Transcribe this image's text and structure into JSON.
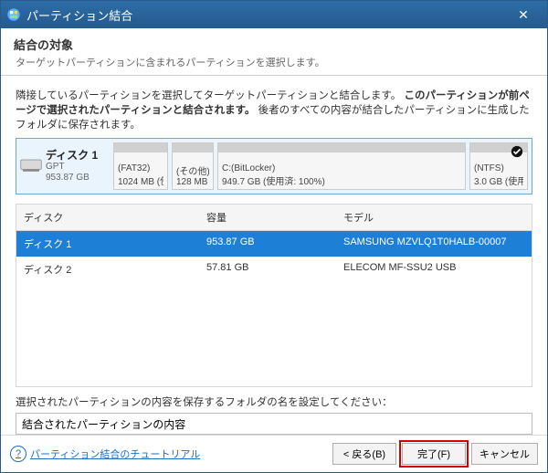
{
  "window": {
    "title": "パーティション結合"
  },
  "header": {
    "heading": "結合の対象",
    "subtitle": "ターゲットパーティションに含まれるパーティションを選択します。"
  },
  "instruction": {
    "pre": "隣接しているパーティションを選択してターゲットパーティションと結合します。",
    "bold": "このパーティションが前ページで選択されたパーティションと結合されます。",
    "post": "後者のすべての内容が結合したパーティションに生成したフォルダに保存されます。"
  },
  "disk_graphic": {
    "disk_name": "ディスク 1",
    "disk_type": "GPT",
    "disk_size": "953.87 GB",
    "partitions": [
      {
        "fs": "(FAT32)",
        "size": "1024 MB (使"
      },
      {
        "fs": "(その他)",
        "size": "128 MB"
      },
      {
        "fs": "C:(BitLocker)",
        "size": "949.7 GB (使用済: 100%)"
      },
      {
        "fs": "(NTFS)",
        "size": "3.0 GB (使用",
        "checked": true
      }
    ]
  },
  "table": {
    "headers": {
      "disk": "ディスク",
      "capacity": "容量",
      "model": "モデル"
    },
    "rows": [
      {
        "disk": "ディスク 1",
        "capacity": "953.87 GB",
        "model": "SAMSUNG MZVLQ1T0HALB-00007",
        "selected": true
      },
      {
        "disk": "ディスク 2",
        "capacity": "57.81 GB",
        "model": "ELECOM MF-SSU2 USB",
        "selected": false
      }
    ]
  },
  "folder": {
    "label": "選択されたパーティションの内容を保存するフォルダの名を設定してください：",
    "value": "結合されたパーティションの内容"
  },
  "footer": {
    "help": "パーティション結合のチュートリアル",
    "back": "< 戻る(B)",
    "finish": "完了(F)",
    "cancel": "キャンセル"
  }
}
